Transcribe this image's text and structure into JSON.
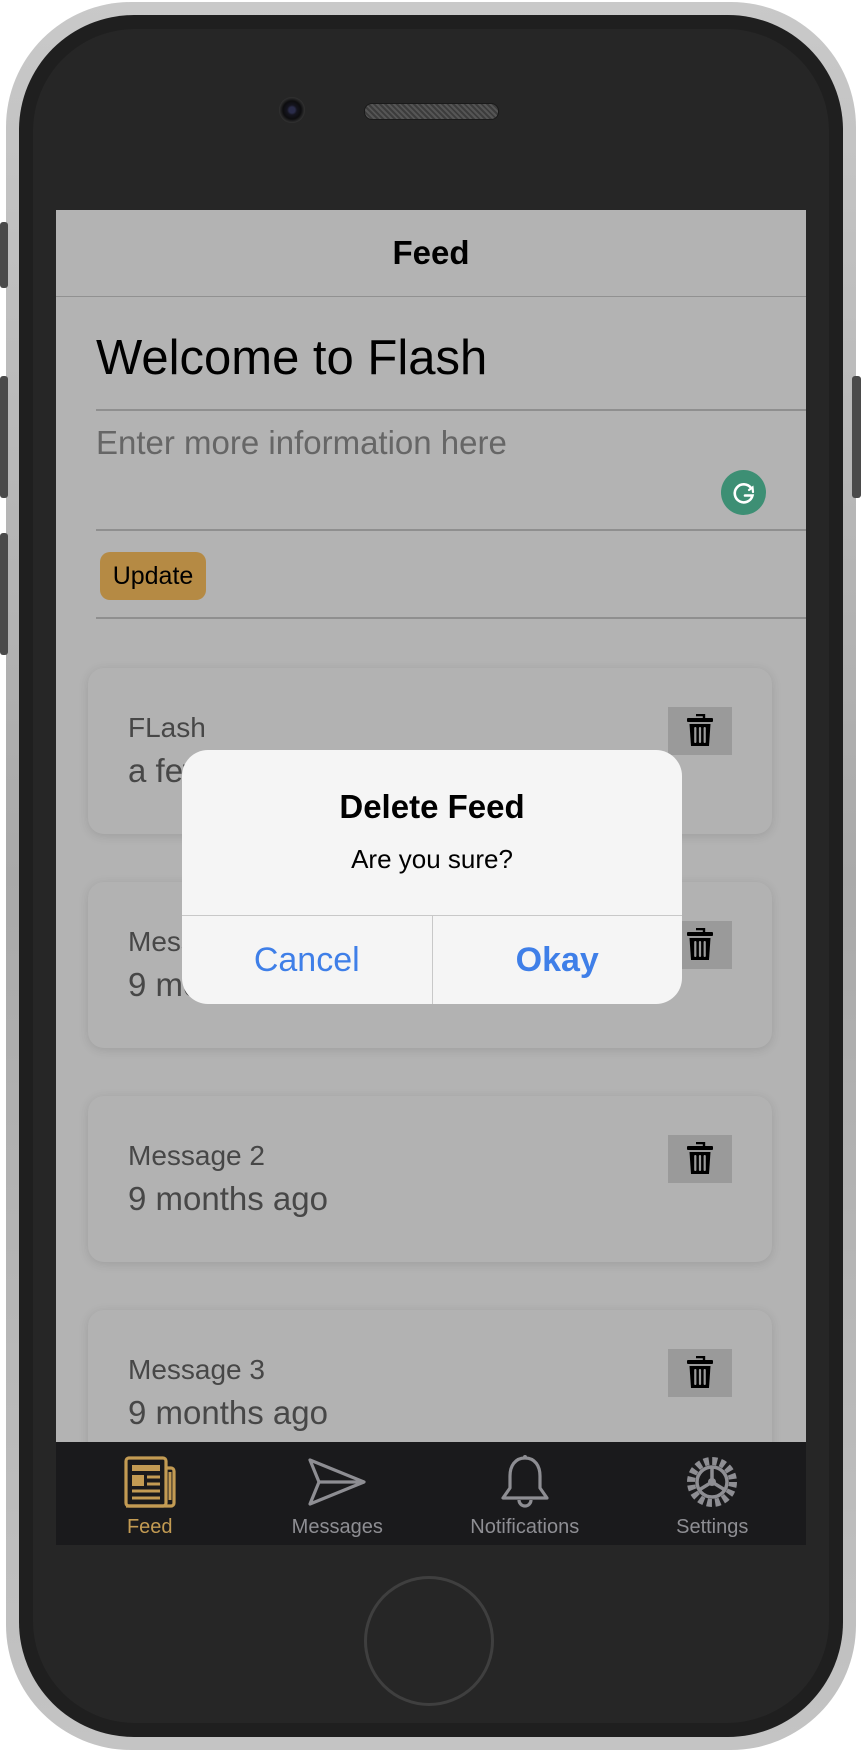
{
  "nav": {
    "title": "Feed"
  },
  "form": {
    "heading": "Welcome to Flash",
    "info_placeholder": "Enter more information here",
    "update_label": "Update"
  },
  "feed": {
    "items": [
      {
        "title": "FLash",
        "time": "a few seconds ago"
      },
      {
        "title": "Message 1",
        "time": "9 months ago"
      },
      {
        "title": "Message 2",
        "time": "9 months ago"
      },
      {
        "title": "Message 3",
        "time": "9 months ago"
      }
    ]
  },
  "dialog": {
    "title": "Delete Feed",
    "message": "Are you sure?",
    "cancel_label": "Cancel",
    "okay_label": "Okay"
  },
  "tabs": [
    {
      "label": "Feed",
      "icon": "newspaper-icon",
      "active": true
    },
    {
      "label": "Messages",
      "icon": "send-icon",
      "active": false
    },
    {
      "label": "Notifications",
      "icon": "bell-icon",
      "active": false
    },
    {
      "label": "Settings",
      "icon": "gear-icon",
      "active": false
    }
  ],
  "colors": {
    "accent": "#c39b53",
    "update_button": "#b58a44",
    "dialog_button": "#3f7fe8",
    "overlay_background": "#b3b3b3",
    "tab_bar": "#1a1a1c"
  }
}
